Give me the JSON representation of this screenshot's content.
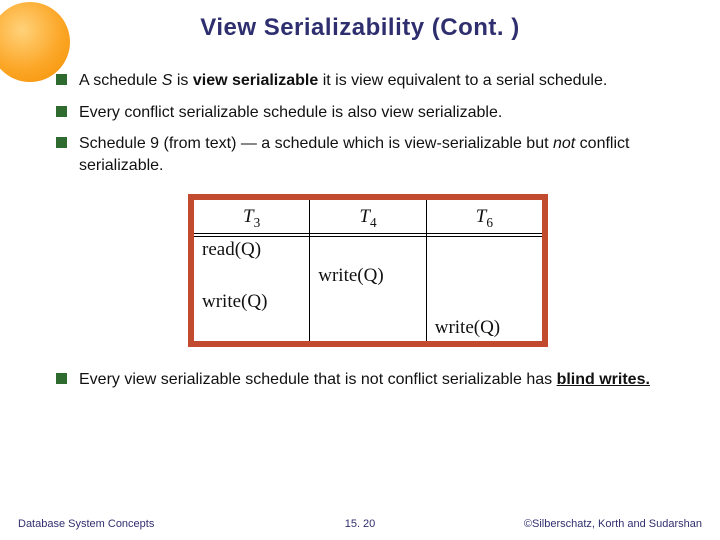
{
  "title": "View Serializability (Cont. )",
  "bullets": {
    "b1_pre": "A schedule ",
    "b1_S": "S",
    "b1_mid": " is ",
    "b1_bold": "view serializable",
    "b1_post": "  it is view equivalent to a serial schedule.",
    "b2": "Every conflict serializable schedule is also view serializable.",
    "b3_pre": "Schedule 9 (from text) — a schedule which is view-serializable but ",
    "b3_not": "not",
    "b3_post": " conflict serializable.",
    "b4_pre": "Every view serializable schedule that is not conflict serializable has ",
    "b4_bold": "blind writes.",
    "b4_post": ""
  },
  "table": {
    "h1_base": "T",
    "h1_sub": "3",
    "h2_base": "T",
    "h2_sub": "4",
    "h3_base": "T",
    "h3_sub": "6",
    "r1c1": "read(Q)",
    "r2c2": "write(Q)",
    "r3c1": "write(Q)",
    "r4c3": "write(Q)"
  },
  "footer": {
    "left": "Database System Concepts",
    "mid": "15. 20",
    "right": "©Silberschatz, Korth and Sudarshan"
  }
}
